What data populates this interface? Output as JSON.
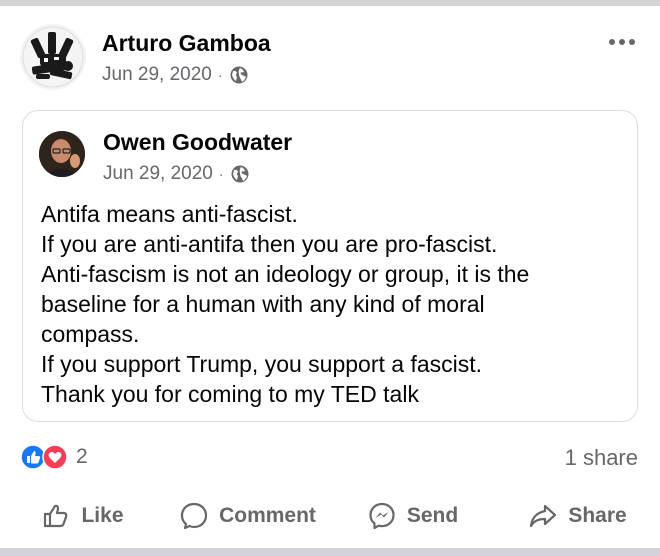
{
  "post": {
    "author": "Arturo Gamboa",
    "date": "Jun 29, 2020",
    "separator": "·",
    "privacy_icon": "globe-icon",
    "more_icon": "more-options-icon"
  },
  "shared_post": {
    "author": "Owen Goodwater",
    "date": "Jun 29, 2020",
    "separator": "·",
    "privacy_icon": "globe-icon",
    "text_lines": [
      "Antifa means anti-fascist.",
      "If you are anti-antifa then you are pro-fascist.",
      "Anti-fascism is not an ideology or group, it is the",
      "baseline for a human with any kind of moral",
      "compass.",
      "If you support Trump, you support a fascist.",
      "Thank you for coming to my TED talk"
    ]
  },
  "engagement": {
    "reaction_count": "2",
    "reaction_icons": [
      "like-reaction-icon",
      "love-reaction-icon"
    ],
    "share_count": "1 share"
  },
  "actions": {
    "like": "Like",
    "comment": "Comment",
    "send": "Send",
    "share": "Share"
  },
  "colors": {
    "like_blue": "#1877f2",
    "love_red": "#f33e58",
    "secondary_text": "#65676b",
    "border": "#dadde1"
  }
}
